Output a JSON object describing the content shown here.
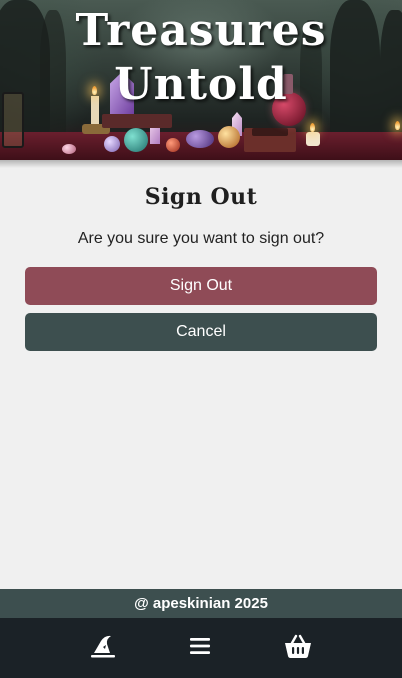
{
  "banner": {
    "title_line1": "Treasures",
    "title_line2": "Untold"
  },
  "main": {
    "title": "Sign Out",
    "prompt": "Are you sure you want to sign out?",
    "sign_out_label": "Sign Out",
    "cancel_label": "Cancel"
  },
  "footer": {
    "credit": "@ apeskinian 2025"
  },
  "nav": {
    "items": [
      {
        "icon": "witch-hat-icon"
      },
      {
        "icon": "hamburger-menu-icon"
      },
      {
        "icon": "shopping-basket-icon"
      }
    ]
  },
  "colors": {
    "background": "#f0f0f0",
    "sign_out_button": "#8f4b57",
    "cancel_button": "#3d4f4f",
    "footer_strip": "#3d4f4f",
    "bottom_nav": "#1b2227"
  }
}
